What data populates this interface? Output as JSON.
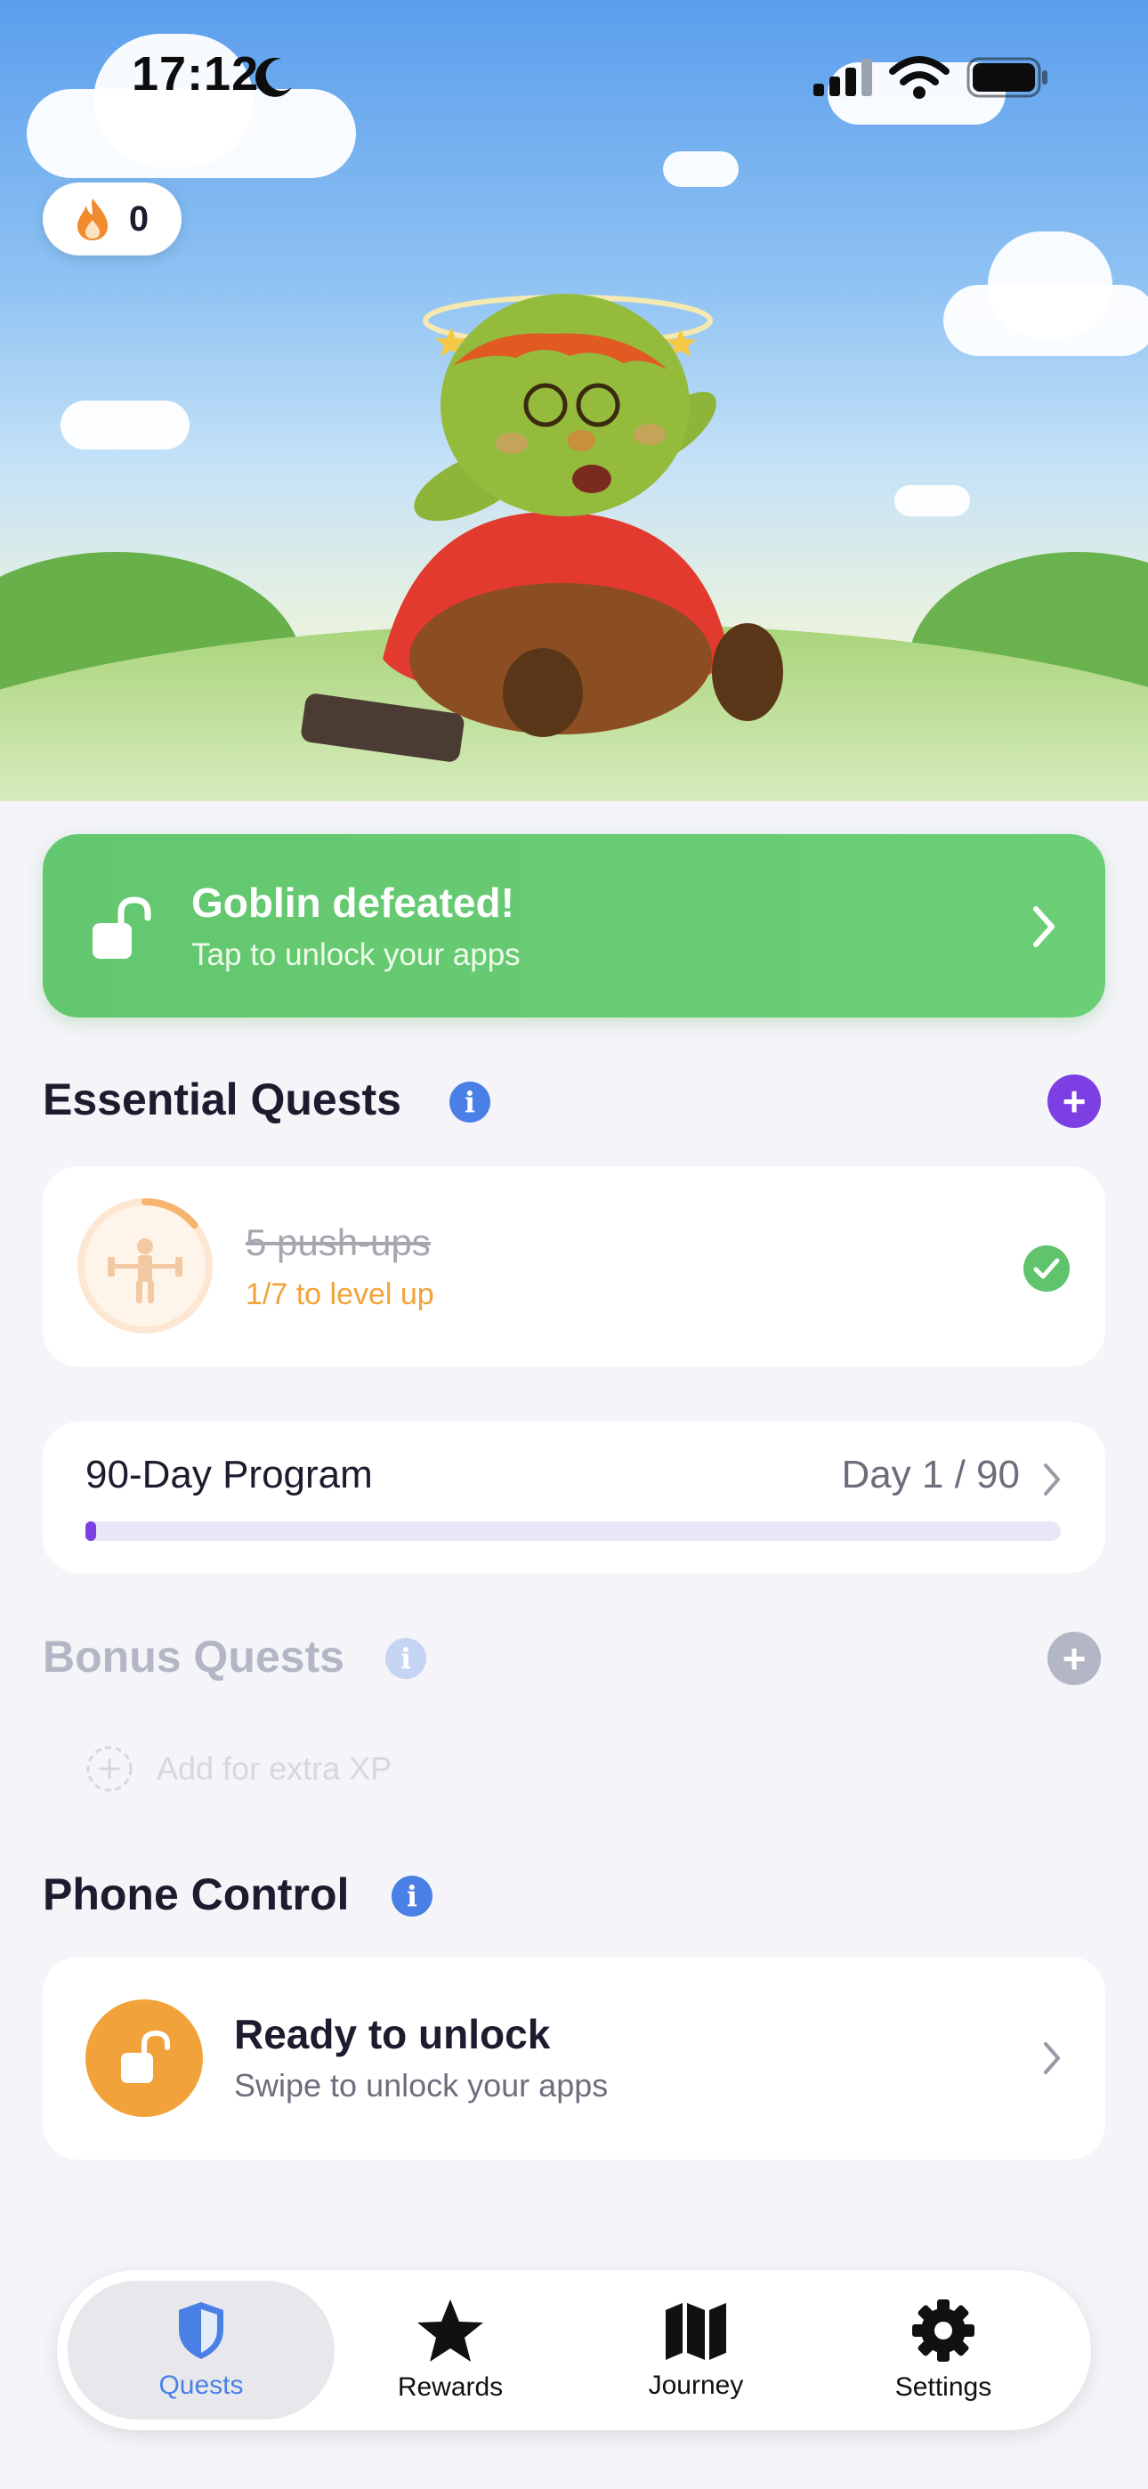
{
  "status_bar": {
    "time": "17:12"
  },
  "streak": {
    "count": "0"
  },
  "banner": {
    "title": "Goblin defeated!",
    "subtitle": "Tap to unlock your apps"
  },
  "essential": {
    "title": "Essential Quests",
    "quest": {
      "name": "5 push-ups",
      "progress_text": "1/7 to level up",
      "level_progress": 0.14,
      "completed": true
    }
  },
  "program": {
    "title": "90-Day Program",
    "day_label": "Day 1 / 90",
    "progress": 0.011
  },
  "bonus": {
    "title": "Bonus Quests",
    "add_label": "Add for extra XP"
  },
  "phone_control": {
    "title": "Phone Control",
    "card_title": "Ready to unlock",
    "card_subtitle": "Swipe to unlock your apps"
  },
  "tabs": [
    {
      "label": "Quests",
      "icon": "shield-icon",
      "active": true
    },
    {
      "label": "Rewards",
      "icon": "star-icon",
      "active": false
    },
    {
      "label": "Journey",
      "icon": "map-icon",
      "active": false
    },
    {
      "label": "Settings",
      "icon": "gear-icon",
      "active": false
    }
  ],
  "colors": {
    "accent": "#4a80e6",
    "success": "#5fc46b",
    "purple": "#7b3fe4",
    "orange": "#f2a23a"
  }
}
